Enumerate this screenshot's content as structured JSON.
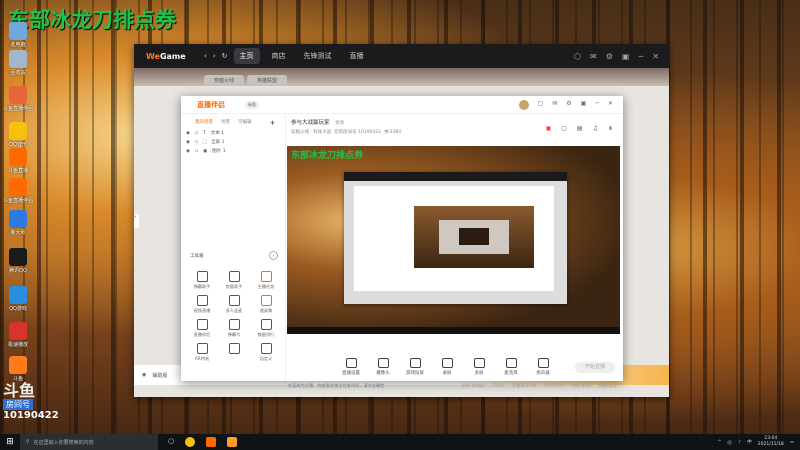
{
  "overlay": {
    "title": "东部冰龙刀排点券"
  },
  "desktop_icons": [
    {
      "label": "此电脑",
      "color": "#6fa8dc"
    },
    {
      "label": "回收站",
      "color": "#9fb8cf"
    },
    {
      "label": "斗鱼直播伴侣",
      "color": "#e8643b"
    },
    {
      "label": "QQ音乐",
      "color": "#f4c20d"
    },
    {
      "label": "斗鱼直播",
      "color": "#ff6a00"
    },
    {
      "label": "斗鱼直播伴侣",
      "color": "#ff6a00"
    },
    {
      "label": "鲁大师",
      "color": "#2d7be0"
    },
    {
      "label": "腾讯QQ",
      "color": "#1a1a1a"
    },
    {
      "label": "QQ游戏",
      "color": "#2b8de0"
    },
    {
      "label": "极速播放",
      "color": "#d9342b"
    },
    {
      "label": "斗鱼",
      "color": "#ff7a1a"
    }
  ],
  "stream_badge": {
    "logo": "斗鱼",
    "label": "房间号",
    "room": "10190422"
  },
  "wegame": {
    "logo_prefix": "We",
    "logo_suffix": "Game",
    "back": "‹",
    "forward": "›",
    "refresh": "↻",
    "tabs": [
      "主页",
      "商店",
      "先锋测试",
      "直播"
    ],
    "subtabs": [
      "穿越火线",
      "英雄联盟"
    ],
    "controls": [
      "⬡",
      "✉",
      "⚙",
      "▣",
      "─",
      "✕"
    ],
    "bottom_text": "辅助版",
    "side_arrow": "›"
  },
  "douyu": {
    "logo": "直播伴侣",
    "version": "新版",
    "window_controls": [
      "▢",
      "✉",
      "⚙",
      "▣",
      "─",
      "✕"
    ],
    "scene_tabs": [
      "我的场景",
      "场景",
      "可编辑"
    ],
    "add": "+",
    "sources": [
      {
        "name": "文本 1"
      },
      {
        "name": "全屏 1"
      },
      {
        "name": "图片 1"
      }
    ],
    "tools_title": "工具箱",
    "tools_more": "›",
    "tools": [
      "弹幕助手",
      "房管助手",
      "主播任务",
      "视频直播",
      "多人连麦",
      "道具聚",
      "直播伴侣",
      "弹幕号",
      "数据排行",
      "AR特效",
      "",
      "自定义"
    ],
    "room_title": "参与大战赢玩家",
    "room_tag": "修改",
    "room_meta": {
      "category": "穿越火线 · 科技大战",
      "room_label": "您的房间号",
      "room_id": "10190422",
      "viewers": "3384"
    },
    "preview_overlay": "东部冰龙刀排点券",
    "controls": [
      "直播设置",
      "摄像头",
      "游戏投屏",
      "录屏",
      "多屏",
      "麦克风",
      "扬声器"
    ],
    "go_live": "开始直播",
    "notice": "欢迎成为主播，完成观众关注任务时间，请点击确定",
    "status": [
      "码率:0kbps",
      "FPS:0",
      "丢帧率:0.0%",
      "CPU:25%",
      "内存:45%",
      "网络:良好"
    ]
  },
  "taskbar": {
    "start": "⊞",
    "search_placeholder": "在这里输入你要搜索的内容",
    "time": "23:04",
    "date": "2021/11/18",
    "lang": "中"
  }
}
